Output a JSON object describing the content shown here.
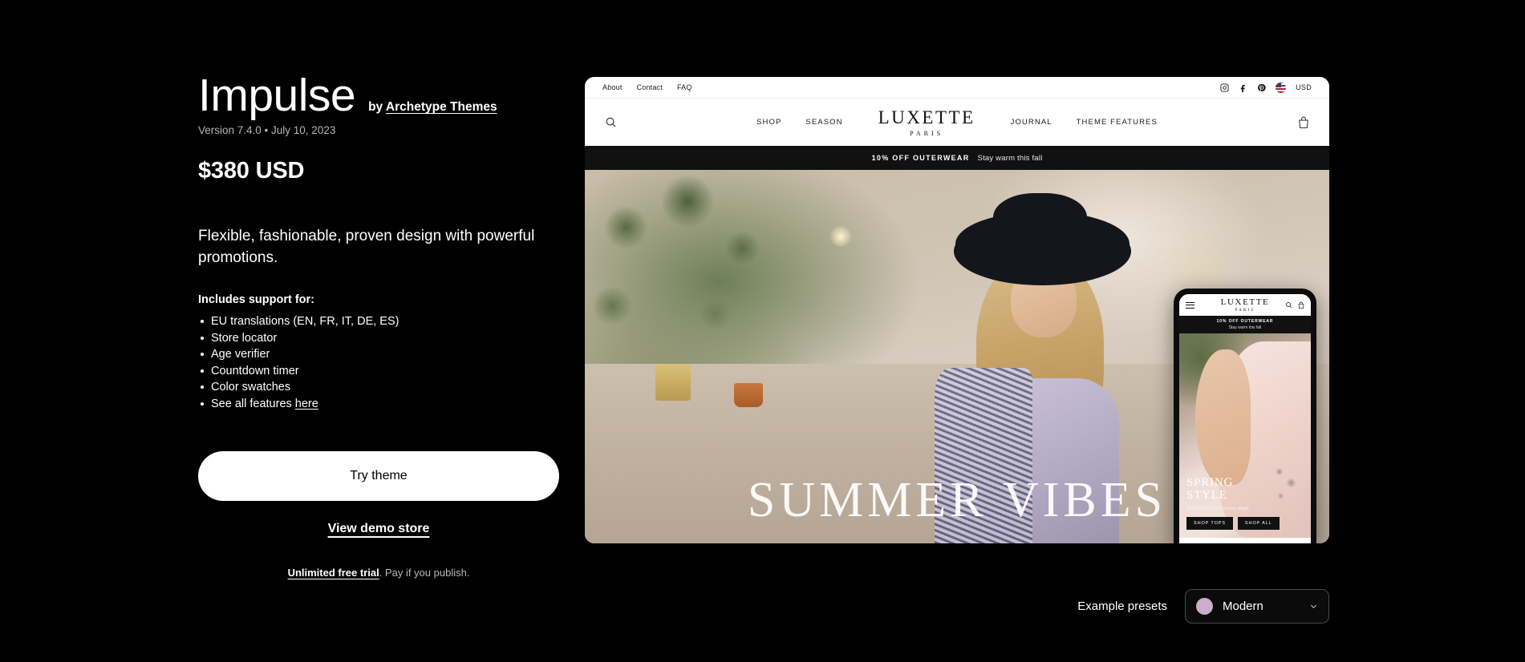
{
  "theme": {
    "title": "Impulse",
    "by_prefix": "by ",
    "author": "Archetype Themes",
    "version_line": "Version 7.4.0 • July 10, 2023",
    "price": "$380 USD",
    "tagline": "Flexible, fashionable, proven design with powerful promotions.",
    "includes_label": "Includes support for:",
    "features": [
      "EU translations (EN, FR, IT, DE, ES)",
      "Store locator",
      "Age verifier",
      "Countdown timer",
      "Color swatches",
      "See all features "
    ],
    "features_link_text": "here",
    "try_button": "Try theme",
    "demo_link": "View demo store",
    "trial_link": "Unlimited free trial",
    "trial_rest": ". Pay if you publish."
  },
  "preview": {
    "topbar": {
      "links": [
        "About",
        "Contact",
        "FAQ"
      ],
      "currency": "USD",
      "social": [
        "instagram-icon",
        "facebook-icon",
        "pinterest-icon"
      ]
    },
    "nav": {
      "search_icon": "search-icon",
      "cart_icon": "cart-icon",
      "left_links": [
        "SHOP",
        "SEASON"
      ],
      "right_links": [
        "JOURNAL",
        "THEME FEATURES"
      ],
      "logo_main": "LUXETTE",
      "logo_sub": "PARIS"
    },
    "promo": {
      "bold": "10% OFF OUTERWEAR",
      "normal": "Stay warm this fall"
    },
    "hero": {
      "headline": "SUMMER VIBES"
    },
    "phone": {
      "logo_main": "LUXETTE",
      "logo_sub": "PARIS",
      "promo_bold": "10% OFF OUTERWEAR",
      "promo_normal": "Stay warm this fall",
      "hero_line1": "SPRING",
      "hero_line2": "STYLE",
      "hero_sub": "Fresh looks for sunny days.",
      "btn1": "SHOP TOPS",
      "btn2": "SHOP ALL"
    }
  },
  "presets": {
    "label": "Example presets",
    "selected": "Modern",
    "swatch_color": "#cbaecb"
  },
  "colors": {
    "background": "#000000",
    "text": "#ffffff",
    "muted": "#b5b5b5",
    "button_bg": "#ffffff",
    "promo_bar": "#111111"
  }
}
